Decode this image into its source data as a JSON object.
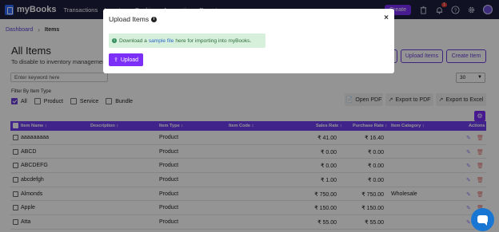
{
  "nav": {
    "brand": "myBooks",
    "links": [
      "Transactions",
      "Inventory",
      "Banking",
      "Accounting",
      "Reports"
    ],
    "create_label": "Create",
    "notification_count": "1"
  },
  "breadcrumb": {
    "parent": "Dashboard",
    "current": "Items"
  },
  "page": {
    "title": "All Items",
    "subtitle": "To disable to inventory management"
  },
  "header_buttons": {
    "upload_items": "Upload Items",
    "create_item": "Create Item"
  },
  "search": {
    "value": "Enter keyword here"
  },
  "page_size": "30",
  "filter": {
    "label": "Filter By Item Type",
    "options": [
      {
        "label": "All",
        "checked": true
      },
      {
        "label": "Product",
        "checked": false
      },
      {
        "label": "Service",
        "checked": false
      },
      {
        "label": "Bundle",
        "checked": false
      }
    ]
  },
  "export": {
    "open_pdf": "Open PDF",
    "export_pdf": "Export to PDF",
    "export_excel": "Export to Excel"
  },
  "table": {
    "columns": {
      "item_name": "Item Name ↕",
      "description": "Description ↕",
      "item_type": "Item Type ↕",
      "item_code": "Item Code ↕",
      "sales_rate": "Sales Rate ↕",
      "purchase_rate": "Purchase Rate ↕",
      "item_category": "Item Category ↕",
      "actions": "Actions"
    },
    "rows": [
      {
        "name": "aaaaaaaaa",
        "description": "",
        "type": "Product",
        "code": "",
        "sales": "₹ 41.00",
        "purchase": "₹ 16.40",
        "category": ""
      },
      {
        "name": "ABCD",
        "description": "",
        "type": "Product",
        "code": "",
        "sales": "₹ 0.00",
        "purchase": "₹ 0.00",
        "category": ""
      },
      {
        "name": "ABCDEFG",
        "description": "",
        "type": "Product",
        "code": "",
        "sales": "₹ 0.00",
        "purchase": "₹ 0.00",
        "category": ""
      },
      {
        "name": "abcdefgh",
        "description": "",
        "type": "Product",
        "code": "",
        "sales": "₹ 1.00",
        "purchase": "₹ 0.00",
        "category": ""
      },
      {
        "name": "Almonds",
        "description": "",
        "type": "Product",
        "code": "",
        "sales": "₹ 750.00",
        "purchase": "₹ 750.00",
        "category": "Wholesale"
      },
      {
        "name": "Apple",
        "description": "",
        "type": "Product",
        "code": "",
        "sales": "₹ 150.00",
        "purchase": "₹ 150.00",
        "category": ""
      },
      {
        "name": "Atta",
        "description": "",
        "type": "Product",
        "code": "",
        "sales": "₹ 55.00",
        "purchase": "₹ 55.00",
        "category": ""
      }
    ]
  },
  "modal": {
    "title": "Upload Items",
    "alert_prefix": "Download a",
    "alert_link": "sample file",
    "alert_suffix": "here for importing into myBooks.",
    "upload_label": "Upload",
    "close_symbol": "×"
  },
  "colors": {
    "nav_bg": "#1c1f3f",
    "accent": "#7b2ff7",
    "table_header": "#6f3ff0",
    "alert_bg": "#d6f0dc",
    "chat_fab": "#1976d2"
  }
}
